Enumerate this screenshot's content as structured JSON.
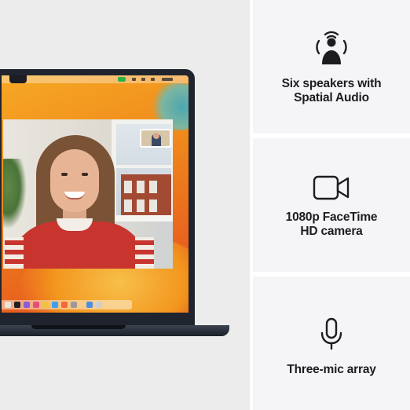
{
  "photo": {
    "subject": "macbook-facetime-screen"
  },
  "features": [
    {
      "icon": "speaker-person-icon",
      "line1": "Six speakers with",
      "line2": "Spatial Audio"
    },
    {
      "icon": "video-camera-icon",
      "line1": "1080p FaceTime",
      "line2": "HD camera"
    },
    {
      "icon": "microphone-icon",
      "line1": "Three-mic array",
      "line2": ""
    }
  ],
  "colors": {
    "card_bg": "#f5f5f7",
    "text": "#1d1d1f",
    "laptop": "#20242e",
    "wallpaper_orange": "#f08a1c"
  }
}
